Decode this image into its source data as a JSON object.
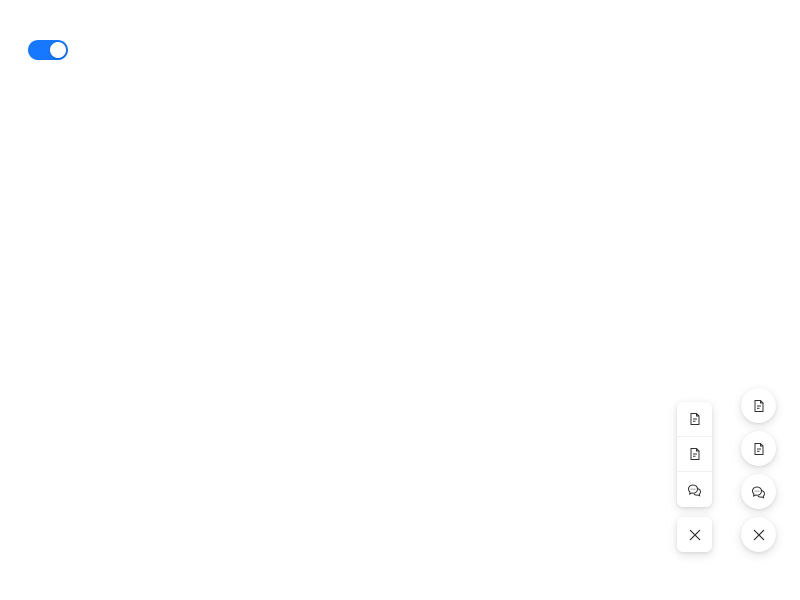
{
  "toggle": {
    "checked": true,
    "accent_color": "#1677ff"
  },
  "square_group": {
    "buttons": [
      {
        "icon": "file-text-icon"
      },
      {
        "icon": "file-text-icon"
      },
      {
        "icon": "comment-icon"
      }
    ],
    "close": {
      "icon": "close-icon"
    }
  },
  "circle_group": {
    "buttons": [
      {
        "icon": "file-text-icon"
      },
      {
        "icon": "file-text-icon"
      },
      {
        "icon": "comment-icon"
      }
    ],
    "close": {
      "icon": "close-icon"
    }
  }
}
